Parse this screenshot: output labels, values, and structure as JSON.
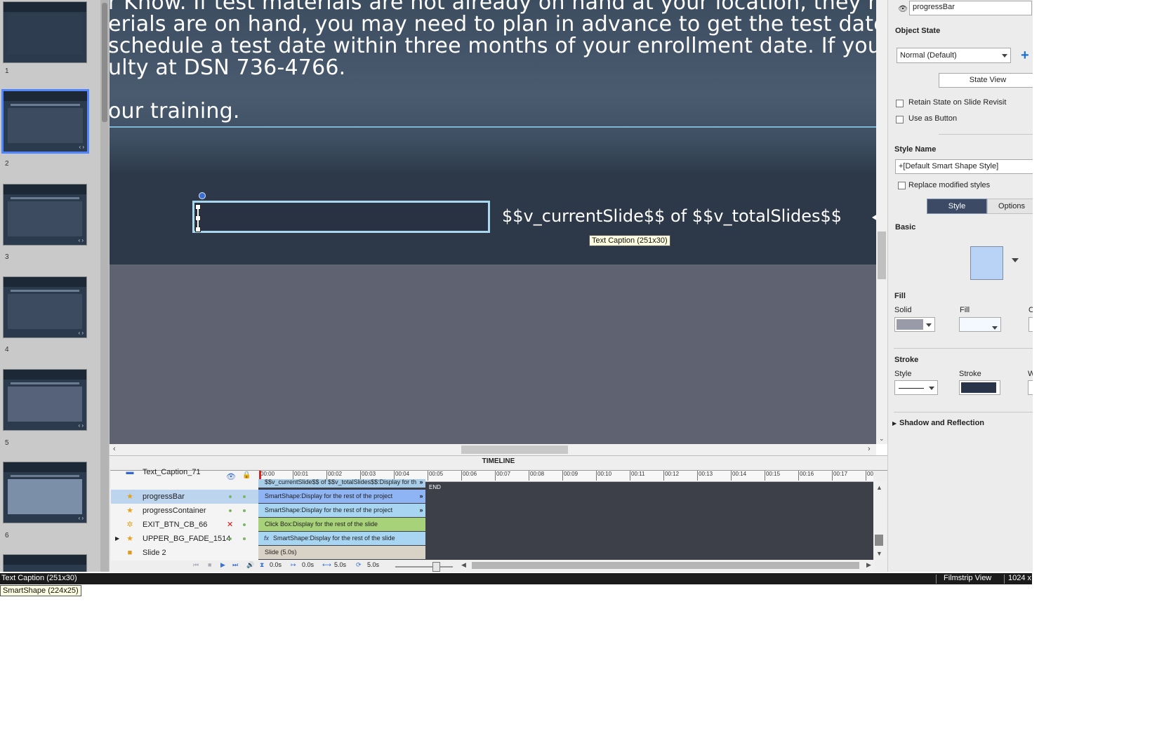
{
  "filmstrip": {
    "slides": [
      {
        "number": "1"
      },
      {
        "number": "2",
        "selected": true
      },
      {
        "number": "3"
      },
      {
        "number": "4"
      },
      {
        "number": "5"
      },
      {
        "number": "6"
      }
    ]
  },
  "slide": {
    "body_lines": [
      "r Know. If test materials are not already on hand at your location, they may nee",
      "erials are on hand, you may need to plan in advance to get the test date you",
      "schedule a test date within three months of your enrollment date. If you have",
      "ulty at DSN 736-4766.",
      "",
      "our training."
    ],
    "progress_caption": "$$v_currentSlide$$ of $$v_totalSlides$$",
    "tooltip": "Text Caption (251x30)"
  },
  "timeline": {
    "title": "TIMELINE",
    "ruler_ticks": [
      "00:00",
      "00:01",
      "00:02",
      "00:03",
      "00:04",
      "00:05",
      "00:06",
      "00:07",
      "00:08",
      "00:09",
      "00:10",
      "00:11",
      "00:12",
      "00:13",
      "00:14",
      "00:15",
      "00:16",
      "00:17",
      "00:"
    ],
    "layers": [
      {
        "name": "Text_Caption_71",
        "bar": "$$v_currentSlide$$ of $$v_totalSlides$$:Display for th"
      },
      {
        "name": "progressBar",
        "bar": "SmartShape:Display for the rest of the project"
      },
      {
        "name": "progressContainer",
        "bar": "SmartShape:Display for the rest of the project"
      },
      {
        "name": "EXIT_BTN_CB_66",
        "bar": "Click Box:Display for the rest of the slide"
      },
      {
        "name": "UPPER_BG_FADE_1514",
        "bar": "SmartShape:Display for the rest of the slide"
      },
      {
        "name": "Slide 2",
        "bar": "Slide (5.0s)"
      }
    ],
    "end_label": "END",
    "footer": {
      "t1": "0.0s",
      "t2": "0.0s",
      "t3": "5.0s",
      "t4": "5.0s"
    }
  },
  "properties": {
    "object_name": "progressBar",
    "object_state_label": "Object State",
    "state_value": "Normal (Default)",
    "state_view_button": "State View",
    "retain_state_label": "Retain State on Slide Revisit",
    "use_as_button_label": "Use as Button",
    "style_name_label": "Style Name",
    "style_name_value": "+[Default Smart Shape Style]",
    "replace_modified_label": "Replace modified styles",
    "tab_style": "Style",
    "tab_options": "Options",
    "basic_label": "Basic",
    "fill_label": "Fill",
    "fill_solid_label": "Solid",
    "fill_fill_label": "Fill",
    "fill_third_label": "O",
    "stroke_label": "Stroke",
    "stroke_style_label": "Style",
    "stroke_stroke_label": "Stroke",
    "stroke_third_label": "W",
    "shadow_label": "Shadow and Reflection",
    "colors": {
      "basic_swatch": "#b9d3f7",
      "fill_swatch": "#9a9ba8",
      "stroke_swatch": "#2a3448"
    }
  },
  "statusbar": {
    "left": "Text Caption (251x30)",
    "view": "Filmstrip View",
    "size": "1024 x"
  },
  "tooltip_smartshape": "SmartShape (224x25)"
}
